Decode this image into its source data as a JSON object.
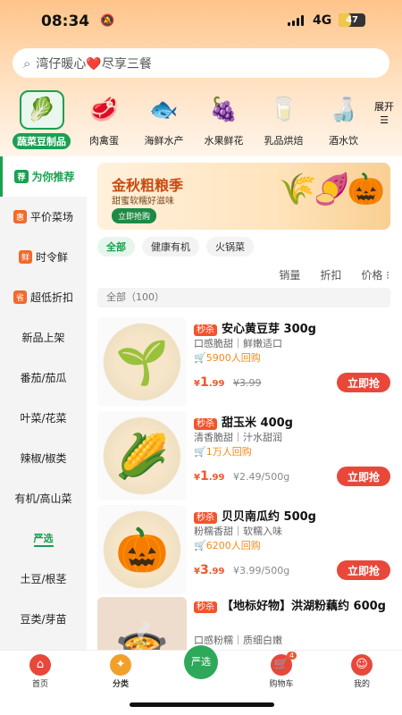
{
  "status": {
    "time": "08:34",
    "network": "4G",
    "battery": "47",
    "battery_level": 0.47
  },
  "search": {
    "placeholder": "湾仔暖心❤️尽享三餐"
  },
  "categories": [
    {
      "label": "蔬菜豆制品",
      "icon": "🥬"
    },
    {
      "label": "肉禽蛋",
      "icon": "🥩"
    },
    {
      "label": "海鲜水产",
      "icon": "🐟"
    },
    {
      "label": "水果鲜花",
      "icon": "🍇"
    },
    {
      "label": "乳品烘焙",
      "icon": "🥛"
    },
    {
      "label": "酒水饮",
      "icon": "🍶"
    }
  ],
  "expand_label": "展开",
  "sidebar": [
    {
      "label": "为你推荐",
      "tag": "荐"
    },
    {
      "label": "平价菜场",
      "tag": "惠"
    },
    {
      "label": "时令鲜",
      "tag": "鲜"
    },
    {
      "label": "超低折扣",
      "tag": "省"
    },
    {
      "label": "新品上架",
      "tag": ""
    },
    {
      "label": "番茄/茄瓜",
      "tag": ""
    },
    {
      "label": "叶菜/花菜",
      "tag": ""
    },
    {
      "label": "辣椒/椒类",
      "tag": ""
    },
    {
      "label": "有机/高山菜",
      "tag": ""
    },
    {
      "label": "严选",
      "tag": ""
    },
    {
      "label": "土豆/根茎",
      "tag": ""
    },
    {
      "label": "豆类/芽苗",
      "tag": ""
    }
  ],
  "banner": {
    "title": "金秋粗粮季",
    "subtitle": "甜蜜软糯好滋味",
    "button": "立即抢购"
  },
  "filters": [
    "全部",
    "健康有机",
    "火锅菜"
  ],
  "sorts": [
    "销量",
    "折扣",
    "价格 ⁝"
  ],
  "count_label": "全部（100）",
  "products": [
    {
      "flash": "秒杀",
      "name": "安心黄豆芽 300g",
      "desc": "口感脆甜｜鲜嫩适口",
      "repurchase": "🛒5900人回购",
      "price_int": "1",
      "price_dec": ".99",
      "orig": "¥3.99",
      "buy": "立即抢",
      "icon": "🌱"
    },
    {
      "flash": "秒杀",
      "name": "甜玉米 400g",
      "desc": "清香脆甜｜汁水甜润",
      "repurchase": "🛒1万人回购",
      "price_int": "1",
      "price_dec": ".99",
      "orig": "¥2.49/500g",
      "buy": "立即抢",
      "icon": "🌽"
    },
    {
      "flash": "秒杀",
      "name": "贝贝南瓜约 500g",
      "desc": "粉糯香甜｜软糯入味",
      "repurchase": "🛒6200人回购",
      "price_int": "3",
      "price_dec": ".99",
      "orig": "¥3.99/500g",
      "buy": "立即抢",
      "icon": "🎃"
    },
    {
      "flash": "秒杀",
      "name": "【地标好物】洪湖粉藕约 600g",
      "desc": "口感粉糯｜质细白嫩",
      "repurchase": "",
      "price_int": "",
      "price_dec": "",
      "orig": "",
      "buy": "",
      "icon": "🍲"
    }
  ],
  "tabbar": [
    {
      "label": "首页",
      "icon": "⌂"
    },
    {
      "label": "分类",
      "icon": "✦"
    },
    {
      "label": "",
      "icon": "严选"
    },
    {
      "label": "购物车",
      "icon": "🛒",
      "badge": "4"
    },
    {
      "label": "我的",
      "icon": "☺"
    }
  ]
}
